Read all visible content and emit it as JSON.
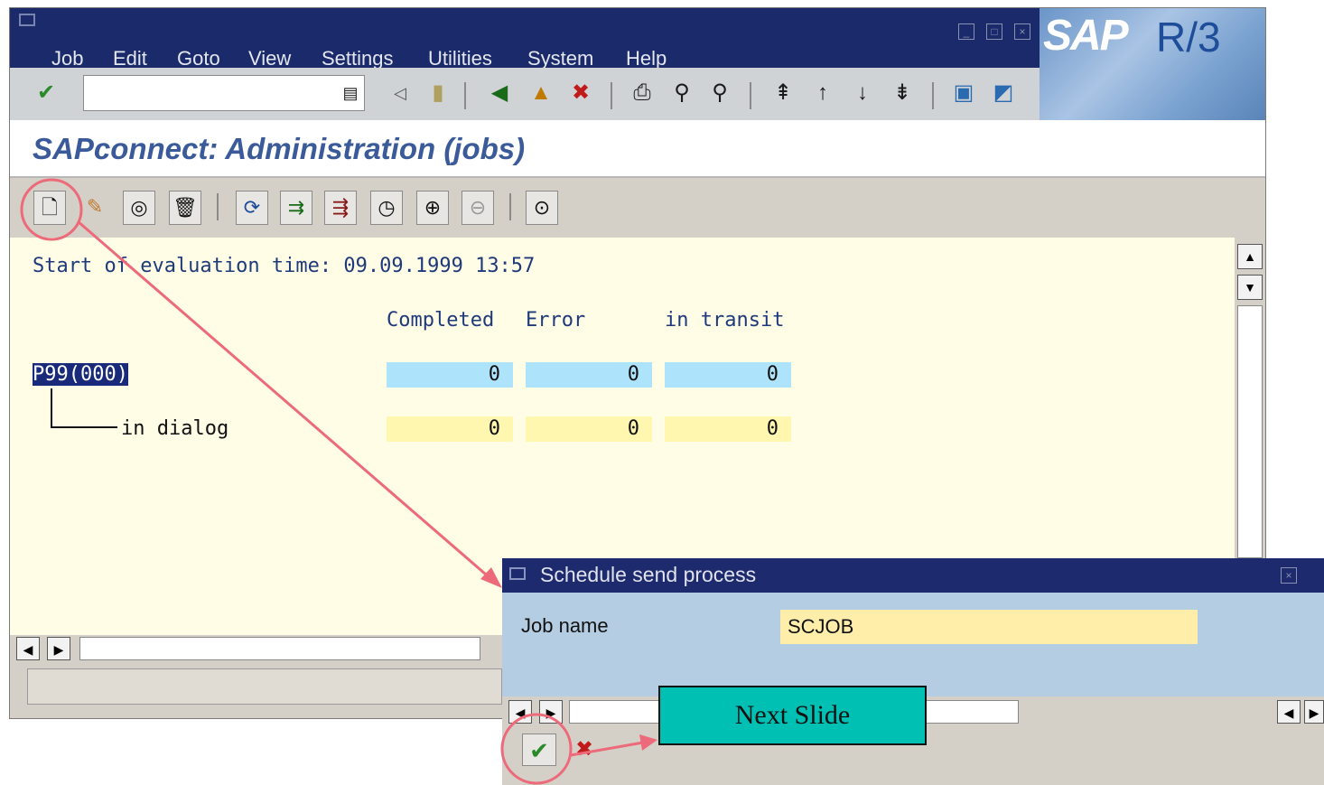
{
  "menubar": {
    "items": [
      "Job",
      "Edit",
      "Goto",
      "View",
      "Settings",
      "Utilities",
      "System",
      "Help"
    ]
  },
  "logo": {
    "brand": "SAP",
    "product": "R/3"
  },
  "header": {
    "title": "SAPconnect: Administration (jobs)"
  },
  "content": {
    "evaluation_line": "Start of evaluation time: 09.09.1999 13:57",
    "columns": [
      "Completed",
      "Error",
      "in transit"
    ],
    "rows": [
      {
        "label": "P99(000)",
        "values": [
          "0",
          "0",
          "0"
        ],
        "color": "#aee4fb"
      },
      {
        "label": "in dialog",
        "values": [
          "0",
          "0",
          "0"
        ],
        "color": "#fff6b0"
      }
    ]
  },
  "dialog": {
    "title": "Schedule send process",
    "job_name_label": "Job name",
    "job_name_value": "SCJOB"
  },
  "callout": {
    "text": "Next Slide"
  },
  "colors": {
    "menubar": "#1a2a6a",
    "title_text": "#3a5a9a",
    "content_bg": "#fffde6",
    "annotation": "#ec6a7a",
    "callout_bg": "#00c0b4",
    "input_bg": "#ffeeaa"
  },
  "icons": {
    "toolbar1": [
      "enter-check-icon",
      "save-icon",
      "back-icon",
      "exit-icon",
      "cancel-icon",
      "print-icon",
      "find-icon",
      "find-next-icon",
      "first-page-icon",
      "previous-page-icon",
      "next-page-icon",
      "last-page-icon",
      "create-session-icon",
      "shortcut-icon"
    ],
    "toolbar2": [
      "create-icon",
      "change-icon",
      "display-icon",
      "delete-icon",
      "refresh-icon",
      "send-icon",
      "send-process-icon",
      "schedule-icon",
      "zoom-in-icon",
      "zoom-out-icon",
      "execute-icon"
    ]
  }
}
